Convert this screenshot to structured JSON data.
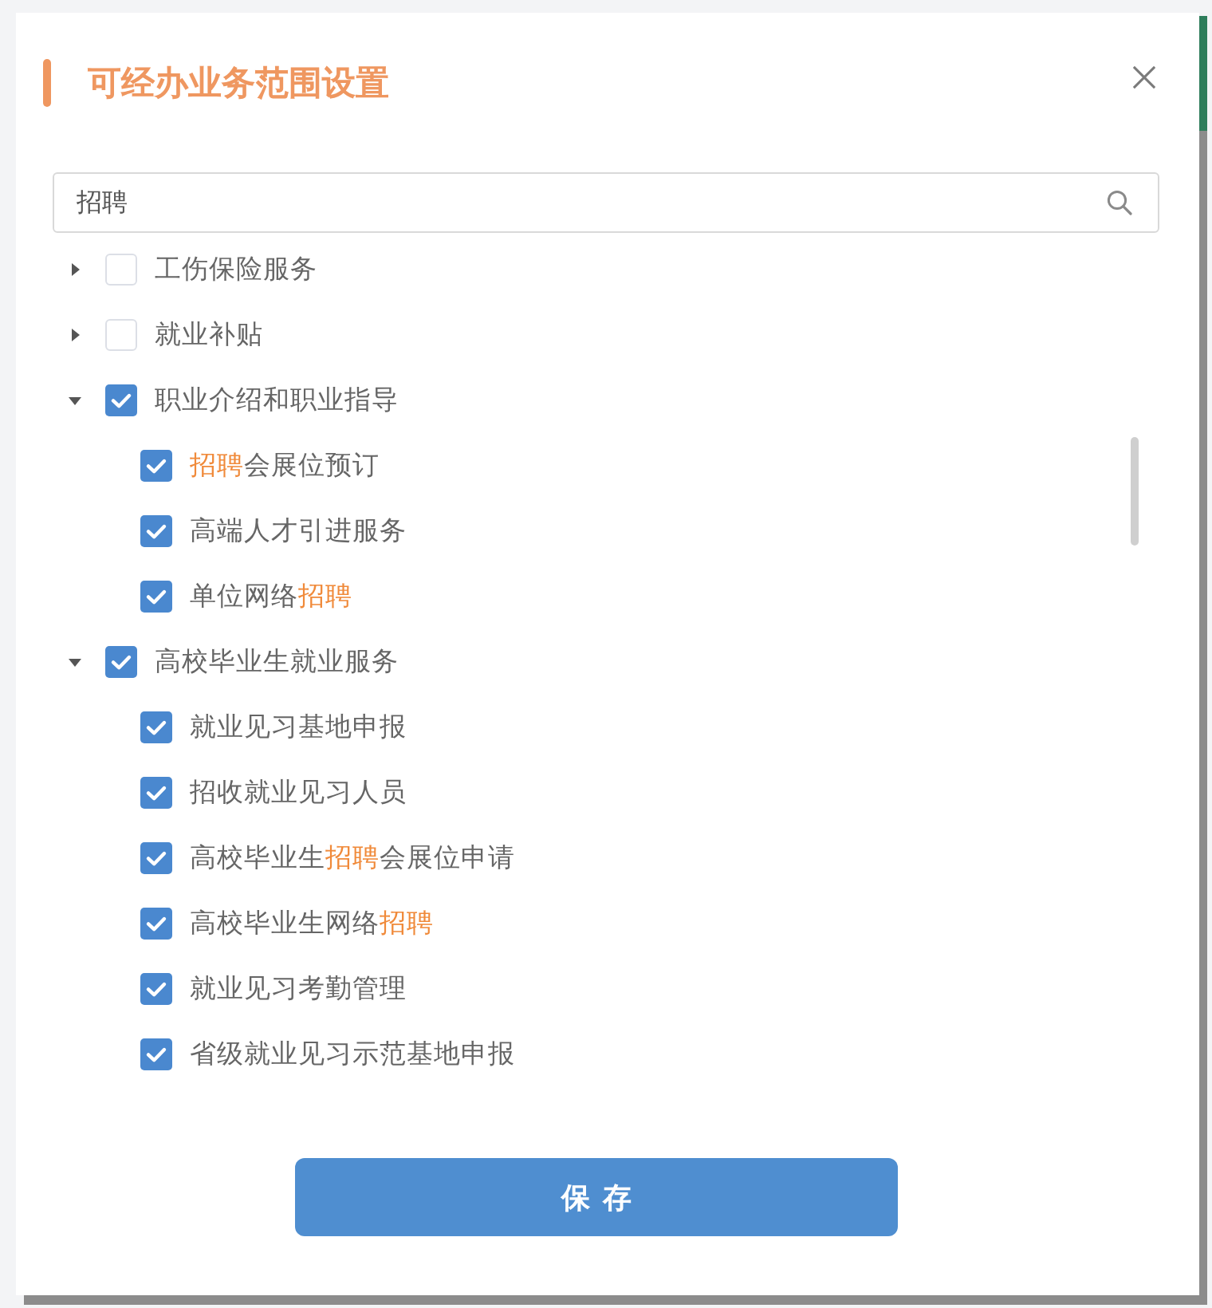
{
  "dialog": {
    "title": "可经办业务范围设置"
  },
  "search": {
    "value": "招聘"
  },
  "tree": {
    "items": [
      {
        "label_parts": [
          {
            "text": "工伤保险服务",
            "highlight": false
          }
        ],
        "checked": false,
        "expanded": false
      },
      {
        "label_parts": [
          {
            "text": "就业补贴",
            "highlight": false
          }
        ],
        "checked": false,
        "expanded": false
      },
      {
        "label_parts": [
          {
            "text": "职业介绍和职业指导",
            "highlight": false
          }
        ],
        "checked": true,
        "expanded": true,
        "children": [
          {
            "label_parts": [
              {
                "text": "招聘",
                "highlight": true
              },
              {
                "text": "会展位预订",
                "highlight": false
              }
            ],
            "checked": true
          },
          {
            "label_parts": [
              {
                "text": "高端人才引进服务",
                "highlight": false
              }
            ],
            "checked": true
          },
          {
            "label_parts": [
              {
                "text": "单位网络",
                "highlight": false
              },
              {
                "text": "招聘",
                "highlight": true
              }
            ],
            "checked": true
          }
        ]
      },
      {
        "label_parts": [
          {
            "text": "高校毕业生就业服务",
            "highlight": false
          }
        ],
        "checked": true,
        "expanded": true,
        "children": [
          {
            "label_parts": [
              {
                "text": "就业见习基地申报",
                "highlight": false
              }
            ],
            "checked": true
          },
          {
            "label_parts": [
              {
                "text": "招收就业见习人员",
                "highlight": false
              }
            ],
            "checked": true
          },
          {
            "label_parts": [
              {
                "text": "高校毕业生",
                "highlight": false
              },
              {
                "text": "招聘",
                "highlight": true
              },
              {
                "text": "会展位申请",
                "highlight": false
              }
            ],
            "checked": true
          },
          {
            "label_parts": [
              {
                "text": "高校毕业生网络",
                "highlight": false
              },
              {
                "text": "招聘",
                "highlight": true
              }
            ],
            "checked": true
          },
          {
            "label_parts": [
              {
                "text": "就业见习考勤管理",
                "highlight": false
              }
            ],
            "checked": true
          },
          {
            "label_parts": [
              {
                "text": "省级就业见习示范基地申报",
                "highlight": false
              }
            ],
            "checked": true
          }
        ]
      }
    ]
  },
  "save_button": {
    "label": "保存"
  }
}
